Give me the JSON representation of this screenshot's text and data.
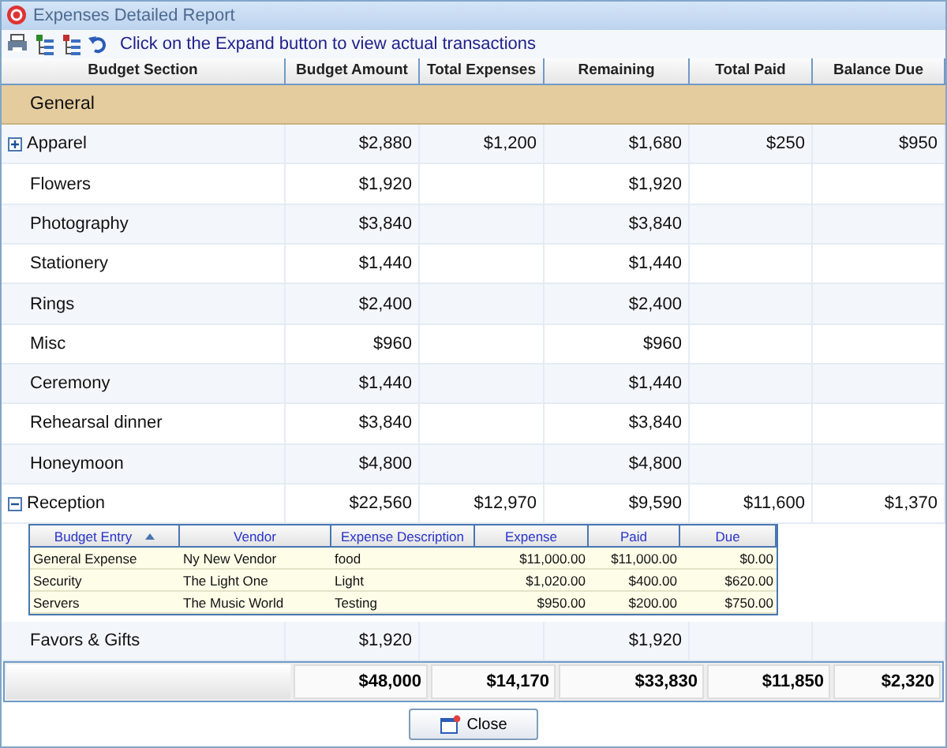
{
  "window": {
    "title": "Expenses Detailed Report"
  },
  "toolbar": {
    "hint": "Click on the Expand button to view actual transactions"
  },
  "table": {
    "columns": [
      "Budget Section",
      "Budget Amount",
      "Total Expenses",
      "Remaining",
      "Total Paid",
      "Balance Due"
    ],
    "rows": [
      {
        "kind": "group",
        "section": "General"
      },
      {
        "kind": "section",
        "section": "Apparel",
        "budget": "$2,880",
        "expenses": "$1,200",
        "remaining": "$1,680",
        "paid": "$250",
        "due": "$950",
        "expanded": false
      },
      {
        "kind": "section",
        "section": "Flowers",
        "budget": "$1,920",
        "remaining": "$1,920"
      },
      {
        "kind": "section",
        "section": "Photography",
        "budget": "$3,840",
        "remaining": "$3,840"
      },
      {
        "kind": "section",
        "section": "Stationery",
        "budget": "$1,440",
        "remaining": "$1,440"
      },
      {
        "kind": "section",
        "section": "Rings",
        "budget": "$2,400",
        "remaining": "$2,400"
      },
      {
        "kind": "section",
        "section": "Misc",
        "budget": "$960",
        "remaining": "$960"
      },
      {
        "kind": "section",
        "section": "Ceremony",
        "budget": "$1,440",
        "remaining": "$1,440"
      },
      {
        "kind": "section",
        "section": "Rehearsal dinner",
        "budget": "$3,840",
        "remaining": "$3,840"
      },
      {
        "kind": "section",
        "section": "Honeymoon",
        "budget": "$4,800",
        "remaining": "$4,800"
      },
      {
        "kind": "section",
        "section": "Reception",
        "budget": "$22,560",
        "expenses": "$12,970",
        "remaining": "$9,590",
        "paid": "$11,600",
        "due": "$1,370",
        "expanded": true,
        "detail": {
          "columns": [
            {
              "label": "Budget Entry",
              "sorted": true
            },
            {
              "label": "Vendor",
              "sorted": false
            },
            {
              "label": "Expense Description",
              "sorted": false
            },
            {
              "label": "Expense",
              "sorted": false
            },
            {
              "label": "Paid",
              "sorted": false
            },
            {
              "label": "Due",
              "sorted": false
            }
          ],
          "entries": [
            {
              "entry": "General Expense",
              "vendor": "Ny New Vendor",
              "description": "food",
              "expense": "$11,000.00",
              "paid": "$11,000.00",
              "due": "$0.00"
            },
            {
              "entry": "Security",
              "vendor": "The Light One",
              "description": "Light",
              "expense": "$1,020.00",
              "paid": "$400.00",
              "due": "$620.00"
            },
            {
              "entry": "Servers",
              "vendor": "The Music World",
              "description": "Testing",
              "expense": "$950.00",
              "paid": "$200.00",
              "due": "$750.00"
            }
          ]
        }
      },
      {
        "kind": "section",
        "section": "Favors & Gifts",
        "budget": "$1,920",
        "remaining": "$1,920"
      }
    ],
    "totals": [
      "$48,000",
      "$14,170",
      "$33,830",
      "$11,850",
      "$2,320"
    ]
  },
  "buttons": [
    {
      "label": "Close"
    }
  ]
}
